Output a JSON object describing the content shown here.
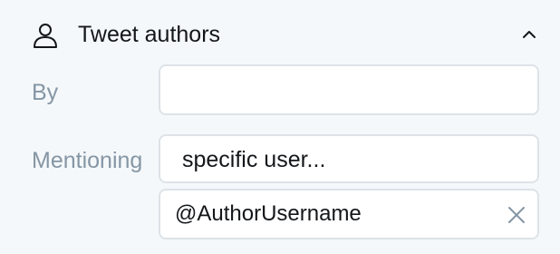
{
  "section": {
    "title": "Tweet authors",
    "icon": "user-icon",
    "toggle_icon": "chevron-up-icon"
  },
  "fields": {
    "by": {
      "label": "By",
      "value": ""
    },
    "mentioning": {
      "label": "Mentioning",
      "selected": "specific user...",
      "username_value": "@AuthorUsername",
      "clear_icon": "close-icon"
    }
  },
  "colors": {
    "background": "#f5f8fa",
    "text": "#14171a",
    "label": "#8596a5",
    "border": "#dde3e8",
    "icon_muted": "#8596a5"
  }
}
